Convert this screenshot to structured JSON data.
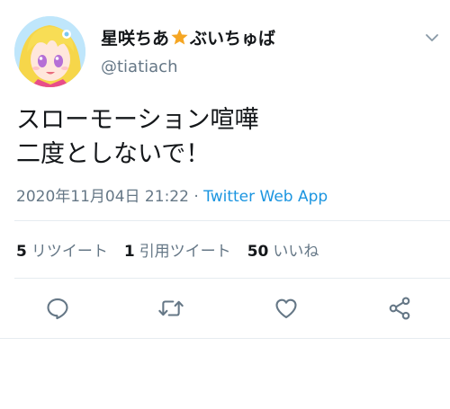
{
  "user": {
    "display_name_part1": "星咲ちあ",
    "display_name_part2": "ぶいちゅば",
    "handle": "@tiatiach"
  },
  "tweet": {
    "line1": "スローモーション喧嘩",
    "line2": "二度としないで！",
    "timestamp": "2020年11月04日 21:22",
    "separator": " · ",
    "source": "Twitter Web App"
  },
  "stats": {
    "retweets_count": "5",
    "retweets_label": "リツイート",
    "quotes_count": "1",
    "quotes_label": "引用ツイート",
    "likes_count": "50",
    "likes_label": "いいね"
  },
  "icons": {
    "star": "star-icon",
    "caret": "chevron-down-icon",
    "reply": "reply-icon",
    "retweet": "retweet-icon",
    "like": "heart-icon",
    "share": "share-icon"
  },
  "colors": {
    "text": "#14171a",
    "secondary": "#657786",
    "link": "#1b95e0",
    "star": "#f5a623"
  }
}
